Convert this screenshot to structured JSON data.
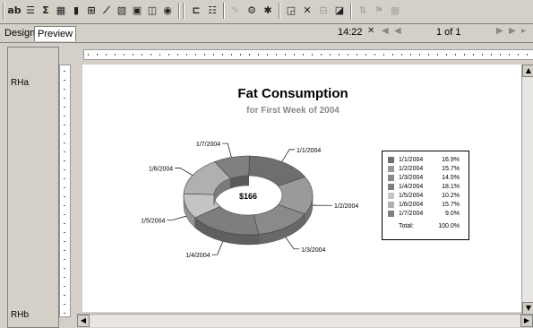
{
  "toolbar": {
    "icons": [
      "ab-icon",
      "list-icon",
      "sigma-icon",
      "table-icon",
      "chart-icon",
      "link-icon",
      "line-icon",
      "image-icon",
      "picture-icon",
      "subreport-icon",
      "map-icon",
      "grid-icon",
      "align-icon",
      "paint-icon",
      "data-icon",
      "params-icon",
      "query-icon",
      "expression-icon",
      "filter-icon",
      "visibility-icon",
      "sort-icon",
      "group-icon"
    ],
    "ab_label": "ab",
    "sigma_label": "Σ"
  },
  "tabs": {
    "design": "Design",
    "preview": "Preview"
  },
  "nav": {
    "time": "14:22",
    "page": "1 of 1"
  },
  "rows": {
    "header": "RHa",
    "footer": "RHb"
  },
  "report": {
    "title": "Fat Consumption",
    "subtitle": "for First Week of 2004",
    "center_label": "$166"
  },
  "chart_data": {
    "type": "pie",
    "variant": "doughnut",
    "title": "Fat Consumption",
    "subtitle": "for First Week of 2004",
    "center_label": "$166",
    "categories": [
      "1/1/2004",
      "1/2/2004",
      "1/3/2004",
      "1/4/2004",
      "1/5/2004",
      "1/6/2004",
      "1/7/2004"
    ],
    "values": [
      16.9,
      15.7,
      14.5,
      18.1,
      10.2,
      15.7,
      9.0
    ],
    "colors": [
      "#6e6e6e",
      "#9a9a9a",
      "#8a8a8a",
      "#7e7e7e",
      "#c4c4c4",
      "#b0b0b0",
      "#808080"
    ],
    "legend": {
      "position": "right",
      "total_label": "Total:",
      "total_value": "100.0%",
      "percent_labels": [
        "16.9%",
        "15.7%",
        "14.5%",
        "18.1%",
        "10.2%",
        "15.7%",
        "9.0%"
      ]
    }
  }
}
